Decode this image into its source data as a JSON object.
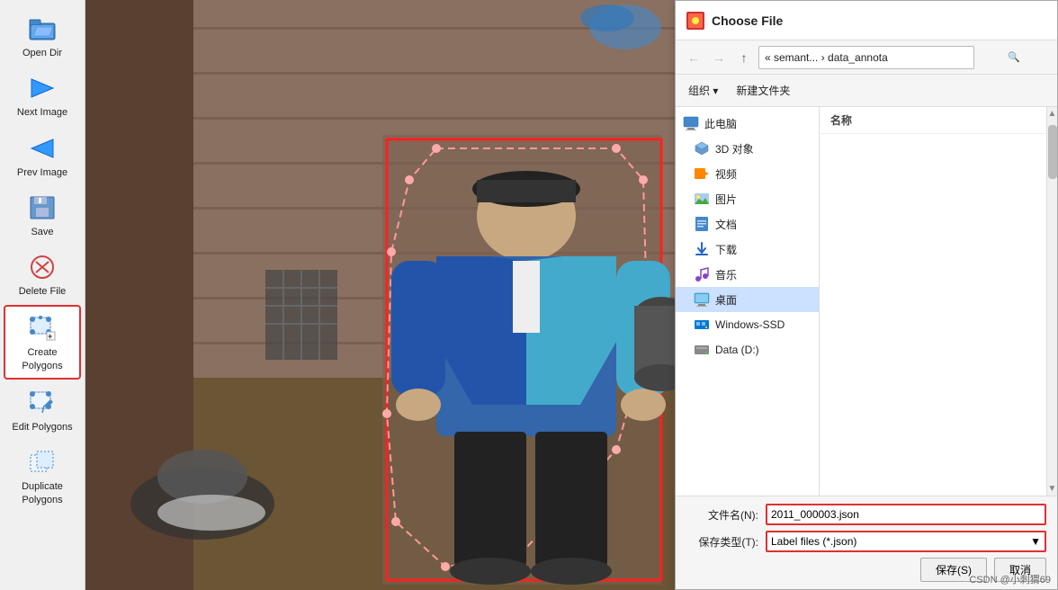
{
  "toolbar": {
    "items": [
      {
        "id": "open-dir",
        "label": "Open\nDir",
        "icon": "folder-open",
        "active": false
      },
      {
        "id": "next-image",
        "label": "Next\nImage",
        "icon": "arrow-right",
        "active": false
      },
      {
        "id": "prev-image",
        "label": "Prev\nImage",
        "icon": "arrow-left",
        "active": false
      },
      {
        "id": "save",
        "label": "Save",
        "icon": "save",
        "active": false
      },
      {
        "id": "delete-file",
        "label": "Delete\nFile",
        "icon": "delete",
        "active": false
      },
      {
        "id": "create-polygons",
        "label": "Create\nPolygons",
        "icon": "polygon",
        "active": true
      },
      {
        "id": "edit-polygons",
        "label": "Edit\nPolygons",
        "icon": "edit",
        "active": false
      },
      {
        "id": "duplicate-polygons",
        "label": "Duplicate\nPolygons",
        "icon": "duplicate",
        "active": false
      }
    ]
  },
  "dialog": {
    "title": "Choose File",
    "breadcrumb": "« semant... › data_annota",
    "toolbar": {
      "organize_label": "组织 ▾",
      "new_folder_label": "新建文件夹"
    },
    "sidebar_items": [
      {
        "id": "this-pc",
        "label": "此电脑",
        "icon": "pc"
      },
      {
        "id": "3d-objects",
        "label": "3D 对象",
        "icon": "3d"
      },
      {
        "id": "videos",
        "label": "视频",
        "icon": "video"
      },
      {
        "id": "pictures",
        "label": "图片",
        "icon": "picture"
      },
      {
        "id": "documents",
        "label": "文档",
        "icon": "document"
      },
      {
        "id": "downloads",
        "label": "下载",
        "icon": "download"
      },
      {
        "id": "music",
        "label": "音乐",
        "icon": "music"
      },
      {
        "id": "desktop",
        "label": "桌面",
        "icon": "desktop",
        "selected": true
      },
      {
        "id": "windows-ssd",
        "label": "Windows-SSD",
        "icon": "drive"
      },
      {
        "id": "data-d",
        "label": "Data (D:)",
        "icon": "drive"
      }
    ],
    "file_list_header": "名称",
    "footer": {
      "filename_label": "文件名(N):",
      "filename_value": "2011_000003.json",
      "filetype_label": "保存类型(T):",
      "filetype_value": "Label files (*.json)",
      "save_btn": "保存(S)",
      "cancel_btn": "取消"
    }
  },
  "watermark": "CSDN @小刺猬69"
}
